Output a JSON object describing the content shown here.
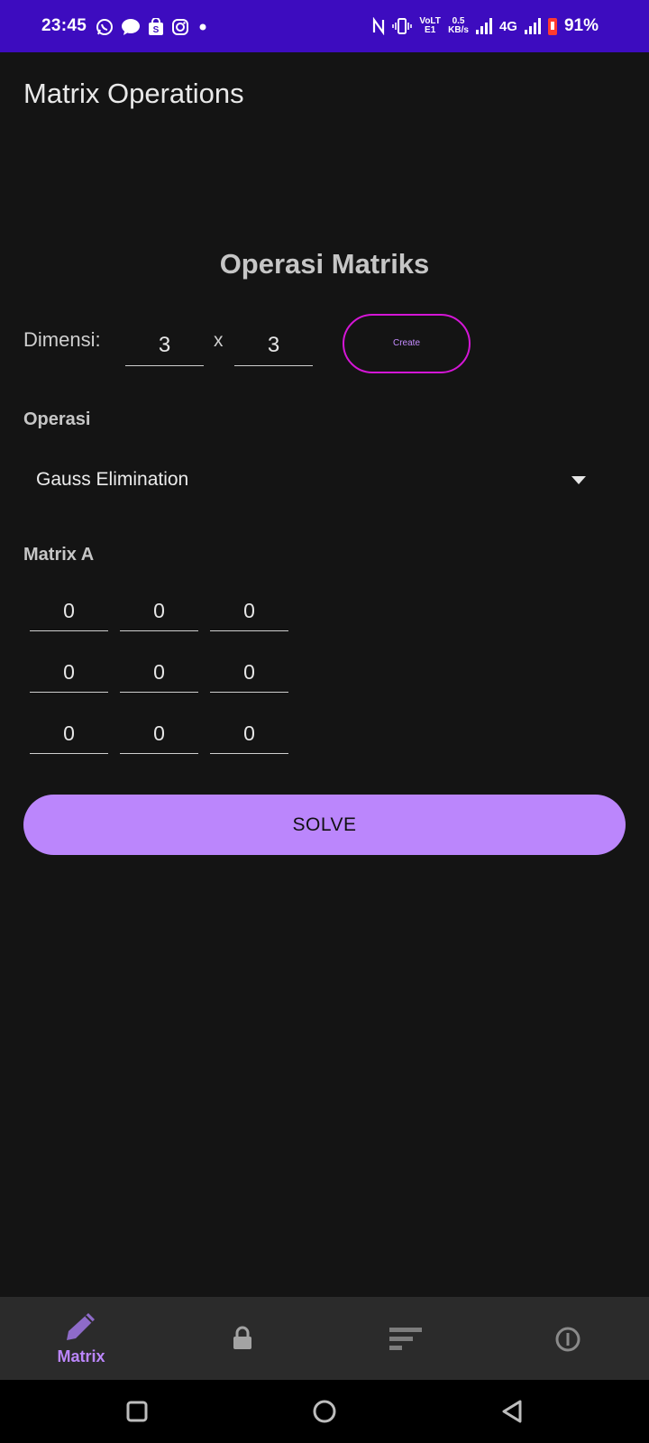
{
  "status_bar": {
    "time": "23:45",
    "lte_label": "VoLTE1",
    "speed_value": "0.5",
    "speed_unit": "KB/s",
    "network": "4G",
    "battery": "91%",
    "background_color": "#3d0cbf",
    "left_icons": [
      "whatsapp-icon",
      "message-icon",
      "shopping-bag-icon",
      "instagram-icon",
      "dot-icon"
    ],
    "right_icons": [
      "nfc-icon",
      "vibrate-icon",
      "signal-icon",
      "signal-icon",
      "battery-icon"
    ]
  },
  "app_bar": {
    "title": "Matrix Operations"
  },
  "main": {
    "heading": "Operasi Matriks",
    "dimension": {
      "label": "Dimensi:",
      "rows": "3",
      "separator": "x",
      "cols": "3",
      "create_label": "Create"
    },
    "operation": {
      "label": "Operasi",
      "selected": "Gauss Elimination"
    },
    "matrix": {
      "label": "Matrix A",
      "rows": [
        [
          "0",
          "0",
          "0"
        ],
        [
          "0",
          "0",
          "0"
        ],
        [
          "0",
          "0",
          "0"
        ]
      ]
    },
    "solve_label": "SOLVE"
  },
  "bottom_nav": {
    "items": [
      {
        "icon": "pencil-icon",
        "label": "Matrix",
        "active": true
      },
      {
        "icon": "lock-icon",
        "label": "",
        "active": false
      },
      {
        "icon": "sort-icon",
        "label": "",
        "active": false
      },
      {
        "icon": "info-icon",
        "label": "",
        "active": false
      }
    ]
  },
  "colors": {
    "accent": "#bb86fc",
    "create_border": "#d416d6",
    "background": "#141414",
    "nav_background": "#2b2b2b"
  }
}
